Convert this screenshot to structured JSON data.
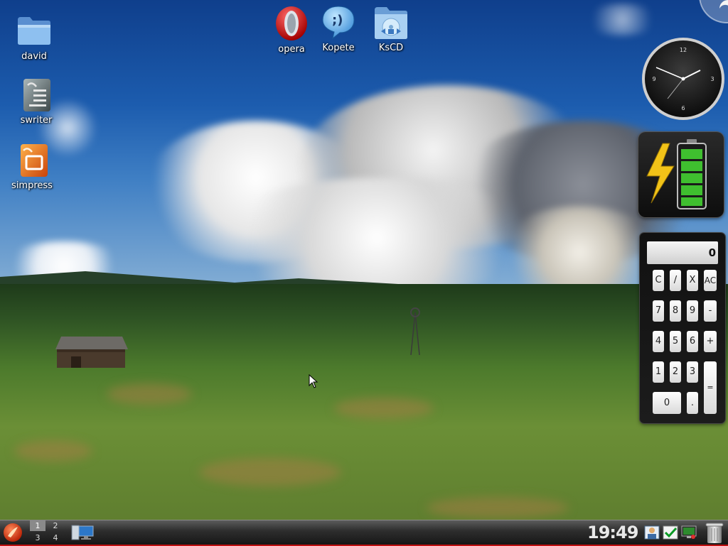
{
  "desktop": {
    "icons": [
      {
        "label": "david",
        "icon": "folder-icon"
      },
      {
        "label": "swriter",
        "icon": "writer-icon"
      },
      {
        "label": "simpress",
        "icon": "impress-icon"
      },
      {
        "label": "opera",
        "icon": "opera-icon"
      },
      {
        "label": "Kopete",
        "icon": "kopete-icon"
      },
      {
        "label": "KsCD",
        "icon": "kscd-icon"
      }
    ]
  },
  "widgets": {
    "clock": {
      "numerals": [
        "12",
        "3",
        "6",
        "9"
      ]
    },
    "battery": {
      "icon": "battery-icon",
      "charging": true,
      "accent": "#f2c318",
      "fill_color": "#3fbf2f"
    },
    "calculator": {
      "display": "0",
      "keys": [
        "C",
        "/",
        "X",
        "AC",
        "7",
        "8",
        "9",
        "-",
        "4",
        "5",
        "6",
        "+",
        "1",
        "2",
        "3",
        "=",
        "0",
        "."
      ]
    }
  },
  "panel": {
    "pager": [
      "1",
      "2",
      "3",
      "4"
    ],
    "active_desktop": "1",
    "time": "19:49",
    "accent": "#c01010"
  }
}
